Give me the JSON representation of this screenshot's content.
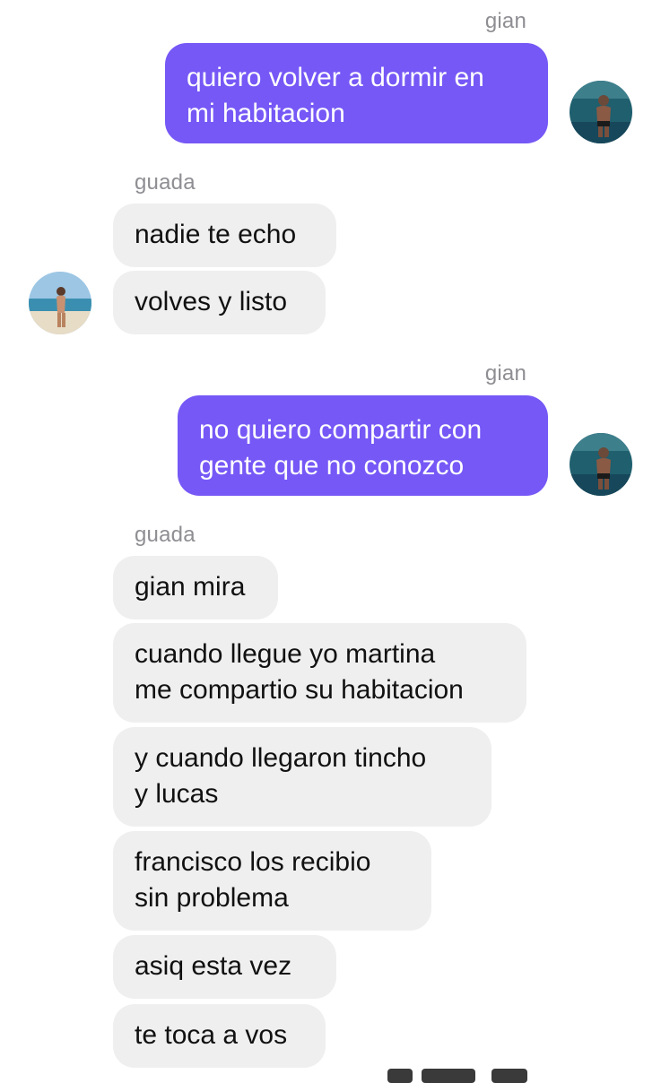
{
  "conversation": {
    "groups": [
      {
        "sender": "gian",
        "direction": "outgoing",
        "messages": [
          "quiero volver a dormir en\nmi habitacion"
        ]
      },
      {
        "sender": "guada",
        "direction": "incoming",
        "messages": [
          "nadie te echo",
          "volves y listo"
        ]
      },
      {
        "sender": "gian",
        "direction": "outgoing",
        "messages": [
          "no quiero compartir con\ngente que no conozco"
        ]
      },
      {
        "sender": "guada",
        "direction": "incoming",
        "messages": [
          "gian mira",
          "cuando llegue yo martina\nme compartio su habitacion",
          "y cuando llegaron tincho\ny lucas",
          "francisco los recibio\nsin problema",
          "asiq esta vez",
          "te toca a vos"
        ]
      }
    ]
  },
  "colors": {
    "outgoing_bubble": "#7658f6",
    "incoming_bubble": "#efefef",
    "sender_label": "#8e8e93"
  },
  "icons": {
    "gian_avatar": "profile-photo-man-in-sea",
    "guada_avatar": "profile-photo-woman-on-beach"
  }
}
